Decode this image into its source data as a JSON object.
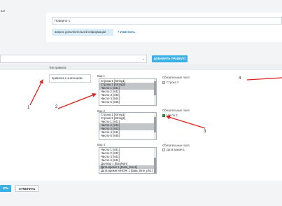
{
  "header": {
    "title": "ват"
  },
  "top": {
    "rule_name_value": "Правило 1",
    "extra_info_link": "Запрос дополнительной информации",
    "edit_link": "+ Изменить"
  },
  "mid": {
    "add_rule_button": "ДОБАВИТЬ ПРАВИЛО"
  },
  "rule": {
    "type_header": "Тип правила",
    "type_value": "привязка к значениям",
    "var1": {
      "label": "Вар 1",
      "options": [
        "Строка 1 [String1]",
        "Строка 2 [String2]",
        "Число 1 [Int1]",
        "Число 2 [Int2]",
        "Число 3 [Int3]",
        "Число 4 [Int4]",
        "Число 5 [Int5]"
      ],
      "selected": [
        1,
        2
      ]
    },
    "req1": {
      "label": "Обязательные поля",
      "items": [
        {
          "text": "Строка 2",
          "checked": false
        }
      ]
    },
    "var2": {
      "label": "Вар 2",
      "options": [
        "Строка 1 [String1]",
        "Строка 2 [String2]",
        "Число 1 [Int1]",
        "Число 2 [Int2]",
        "Число 3 [Int3]",
        "Число 4 [Int4]",
        "Число 5 [Int5]"
      ],
      "selected": [
        3,
        4
      ]
    },
    "req2": {
      "label": "Обязательные поля",
      "items": [
        {
          "text": "Число 2",
          "checked": true
        }
      ]
    },
    "var3": {
      "label": "Вар 3",
      "options": [
        "Число 1 [Int1]",
        "Число 2 [Int2]",
        "Число 3 [Int3]",
        "Число 4 [Int4]",
        "Доллар 1 [Boolean]",
        "Дата время 1 [Data_time1]",
        "Дата время МНОЖ 1 [data_time_plr1]"
      ],
      "selected": [
        5
      ]
    },
    "req3": {
      "label": "Обязательные поля",
      "items": [
        {
          "text": "Дата время 1",
          "checked": false
        }
      ]
    }
  },
  "footer": {
    "save_button": "ИТЬ",
    "cancel_button": "ОТМЕНИТЬ"
  },
  "annotations": [
    "1",
    "2",
    "3",
    "4"
  ],
  "colors": {
    "accent": "#3bb0e5",
    "arrow": "#e0201e",
    "selected_row": "#c3c6c9"
  }
}
